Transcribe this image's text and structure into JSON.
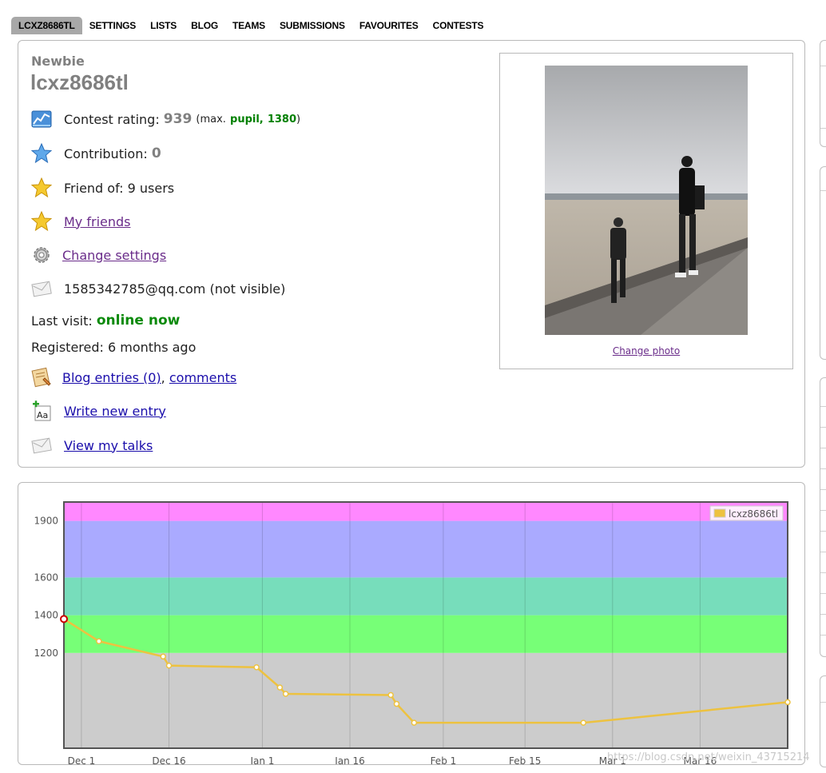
{
  "nav": {
    "tabs": [
      "LCXZ8686TL",
      "SETTINGS",
      "LISTS",
      "BLOG",
      "TEAMS",
      "SUBMISSIONS",
      "FAVOURITES",
      "CONTESTS"
    ],
    "active": 0
  },
  "profile": {
    "rank": "Newbie",
    "handle": "lcxz8686tl",
    "contest_rating_label": "Contest rating:",
    "contest_rating": "939",
    "max_open": "(max.",
    "max_rank": "pupil,",
    "max_rating": "1380",
    "max_close": ")",
    "contribution_label": "Contribution:",
    "contribution": "0",
    "friend_of": "Friend of: 9 users",
    "my_friends": "My friends",
    "change_settings": "Change settings",
    "email": "1585342785@qq.com (not visible)",
    "last_visit_label": "Last visit:",
    "last_visit": "online now",
    "registered": "Registered: 6 months ago",
    "blog_entries": "Blog entries (0)",
    "comma": ",",
    "comments": "comments",
    "write_new_entry": "Write new entry",
    "view_my_talks": "View my talks",
    "change_photo": "Change photo"
  },
  "icons": {
    "rating": "rating-chart-icon",
    "contribution": "blue-star-icon",
    "friends": "gold-star-icon",
    "settings": "gear-icon",
    "email": "envelope-icon",
    "blog": "blog-icon",
    "write": "write-entry-icon",
    "talks": "envelope-icon"
  },
  "watermark": "https://blog.csdn.net/weixin_43715214",
  "chart_data": {
    "type": "line",
    "series": [
      {
        "name": "lcxz8686tl",
        "color": "#edc240",
        "x": [
          "2019-11-28",
          "2019-12-04",
          "2019-12-15",
          "2019-12-16",
          "2019-12-31",
          "2020-01-04",
          "2020-01-05",
          "2020-01-23",
          "2020-01-24",
          "2020-01-27",
          "2020-02-25",
          "2020-03-31"
        ],
        "y": [
          1380,
          1262,
          1181,
          1133,
          1124,
          1017,
          983,
          977,
          930,
          830,
          830,
          939
        ]
      }
    ],
    "x_ticks": [
      "Dec 1",
      "Dec 16",
      "Jan 1",
      "Jan 16",
      "Feb 1",
      "Feb 15",
      "Mar 1",
      "Mar 16"
    ],
    "x_tick_dates": [
      "2019-12-01",
      "2019-12-16",
      "2020-01-01",
      "2020-01-16",
      "2020-02-01",
      "2020-02-15",
      "2020-03-01",
      "2020-03-16"
    ],
    "y_ticks": [
      1200,
      1400,
      1600,
      1900
    ],
    "xlim": [
      "2019-11-28",
      "2020-03-31"
    ],
    "ylim": [
      695,
      2000
    ],
    "bands": [
      {
        "from": 695,
        "to": 1200,
        "color": "#cccccc"
      },
      {
        "from": 1200,
        "to": 1400,
        "color": "#77ff77"
      },
      {
        "from": 1400,
        "to": 1600,
        "color": "#77ddbb"
      },
      {
        "from": 1600,
        "to": 1900,
        "color": "#aaaaff"
      },
      {
        "from": 1900,
        "to": 2000,
        "color": "#ff88ff"
      }
    ],
    "legend_position": "top-right",
    "grid": true
  }
}
